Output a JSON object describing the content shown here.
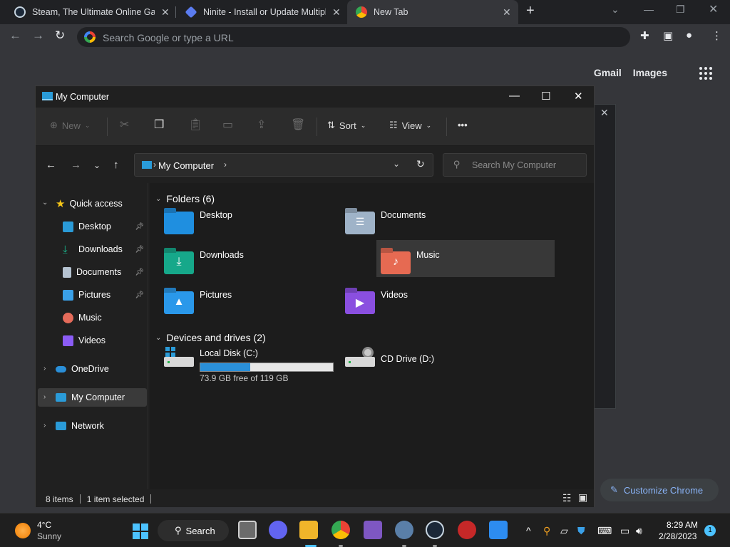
{
  "chrome": {
    "tabs": [
      {
        "title": "Steam, The Ultimate Online Game",
        "close": "✕"
      },
      {
        "title": "Ninite - Install or Update Multiple",
        "close": "✕"
      },
      {
        "title": "New Tab",
        "close": "✕"
      }
    ],
    "new_tab": "+",
    "omnibox_placeholder": "Search Google or type a URL",
    "ntp_links": {
      "gmail": "Gmail",
      "images": "Images"
    },
    "customize_chrome": "Customize Chrome"
  },
  "explorer": {
    "title": "My Computer",
    "commands": {
      "new": "New",
      "sort": "Sort",
      "view": "View",
      "more": "•••"
    },
    "address": {
      "location": "My Computer",
      "search_placeholder": "Search My Computer"
    },
    "sidebar": {
      "quick_access": "Quick access",
      "pinned": [
        {
          "label": "Desktop",
          "color": "#2a9bd8"
        },
        {
          "label": "Downloads",
          "color": "#1ab38a"
        },
        {
          "label": "Documents",
          "color": "#b5c3d1"
        },
        {
          "label": "Pictures",
          "color": "#3aa0e8"
        },
        {
          "label": "Music",
          "color": "#e56b5a"
        },
        {
          "label": "Videos",
          "color": "#8b5cf6"
        }
      ],
      "onedrive": "OneDrive",
      "my_computer": "My Computer",
      "network": "Network"
    },
    "folders_header": "Folders (6)",
    "folders": [
      {
        "label": "Desktop",
        "color": "#1f8fe0"
      },
      {
        "label": "Documents",
        "color": "#9fb3c8"
      },
      {
        "label": "Downloads",
        "color": "#16a88a"
      },
      {
        "label": "Music",
        "color": "#e66a52"
      },
      {
        "label": "Pictures",
        "color": "#2a98ea"
      },
      {
        "label": "Videos",
        "color": "#8a4fe0"
      }
    ],
    "drives_header": "Devices and drives (2)",
    "drives": [
      {
        "label": "Local Disk (C:)",
        "free": "73.9 GB free of 119 GB",
        "used_fraction": 0.379
      },
      {
        "label": "CD Drive (D:)"
      }
    ],
    "status": {
      "items": "8 items",
      "selected": "1 item selected"
    }
  },
  "taskbar": {
    "weather_temp": "4°C",
    "weather_desc": "Sunny",
    "search_label": "Search",
    "time": "8:29 AM",
    "date": "2/28/2023",
    "notification_count": "1"
  }
}
